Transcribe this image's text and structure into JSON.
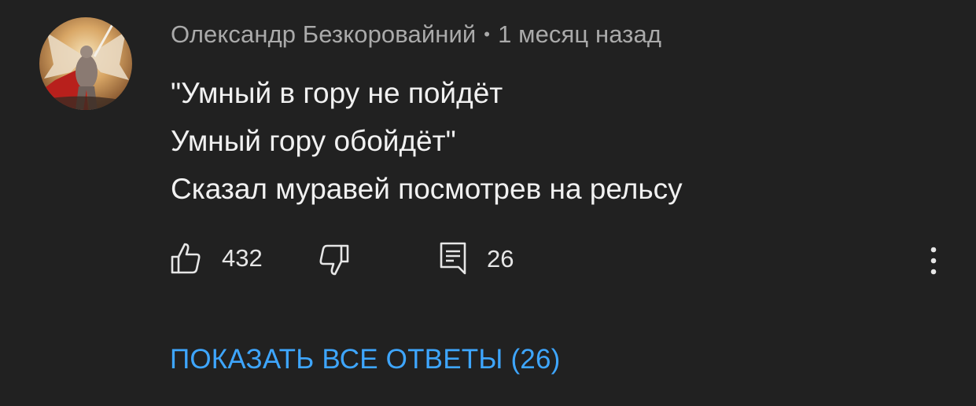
{
  "comment": {
    "author": "Олександр Безкоровайний",
    "separator": "•",
    "time": "1 месяц назад",
    "lines": [
      "\"Умный в гору не пойдёт",
      "Умный гору обойдёт\"",
      "Сказал муравей посмотрев на рельсу"
    ],
    "likes": "432",
    "replies_count": "26"
  },
  "actions": {
    "show_all_replies": "ПОКАЗАТЬ ВСЕ ОТВЕТЫ (26)"
  },
  "icons": {
    "like": "thumbs-up-icon",
    "dislike": "thumbs-down-icon",
    "reply": "reply-icon",
    "more": "more-vert-icon"
  },
  "colors": {
    "background": "#212121",
    "text": "#f1f1f1",
    "meta": "#aaaaaa",
    "link": "#3ea6ff"
  }
}
